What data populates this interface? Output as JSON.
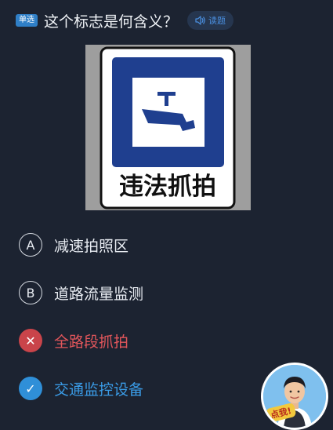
{
  "question": {
    "type_label": "单选",
    "text": "这个标志是何含义？",
    "read_label": "读题"
  },
  "sign": {
    "caption": "违法抓拍"
  },
  "options": [
    {
      "letter": "A",
      "text": "减速拍照区",
      "state": "default"
    },
    {
      "letter": "B",
      "text": "道路流量监测",
      "state": "default"
    },
    {
      "letter": "✕",
      "text": "全路段抓拍",
      "state": "wrong"
    },
    {
      "letter": "✓",
      "text": "交通监控设备",
      "state": "correct"
    }
  ],
  "assistant": {
    "badge_label": "点我!"
  },
  "colors": {
    "background": "#1c2331",
    "badge_blue": "#2f7fc7",
    "wrong_red": "#c9444a",
    "correct_blue": "#2f8fd8",
    "sign_blue": "#1f3f8f"
  }
}
